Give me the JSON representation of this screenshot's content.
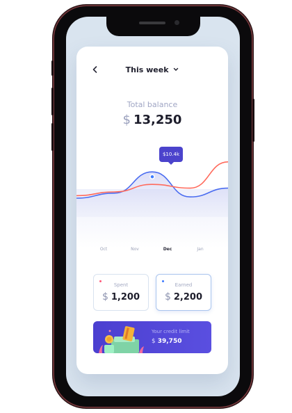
{
  "header": {
    "title": "This week",
    "chevron_icon": "chevron-down-icon",
    "back_icon": "back-arrow-icon"
  },
  "balance": {
    "label": "Total balance",
    "currency": "$",
    "amount": "13,250"
  },
  "chart_data": {
    "type": "line",
    "x": [
      "Oct",
      "Nov",
      "Dec",
      "Jan"
    ],
    "active_month": "Dec",
    "tooltip": "$10.4k",
    "series": [
      {
        "values": [
          0.3,
          0.38,
          0.72,
          0.32,
          0.46
        ],
        "color": "#4a6cf0"
      },
      {
        "values": [
          0.34,
          0.4,
          0.52,
          0.46,
          0.88
        ],
        "color": "#ff6a5c"
      }
    ]
  },
  "stats": [
    {
      "label": "Spent",
      "currency": "$",
      "value": "1,200",
      "dot_color": "#ff5a7a"
    },
    {
      "label": "Earned",
      "currency": "$",
      "value": "2,200",
      "dot_color": "#3d7bff"
    }
  ],
  "credit": {
    "label": "Your credit limit",
    "currency": "$",
    "value": "39,750"
  },
  "colors": {
    "accent": "#4b43cc",
    "background": "#d9e4ef"
  }
}
